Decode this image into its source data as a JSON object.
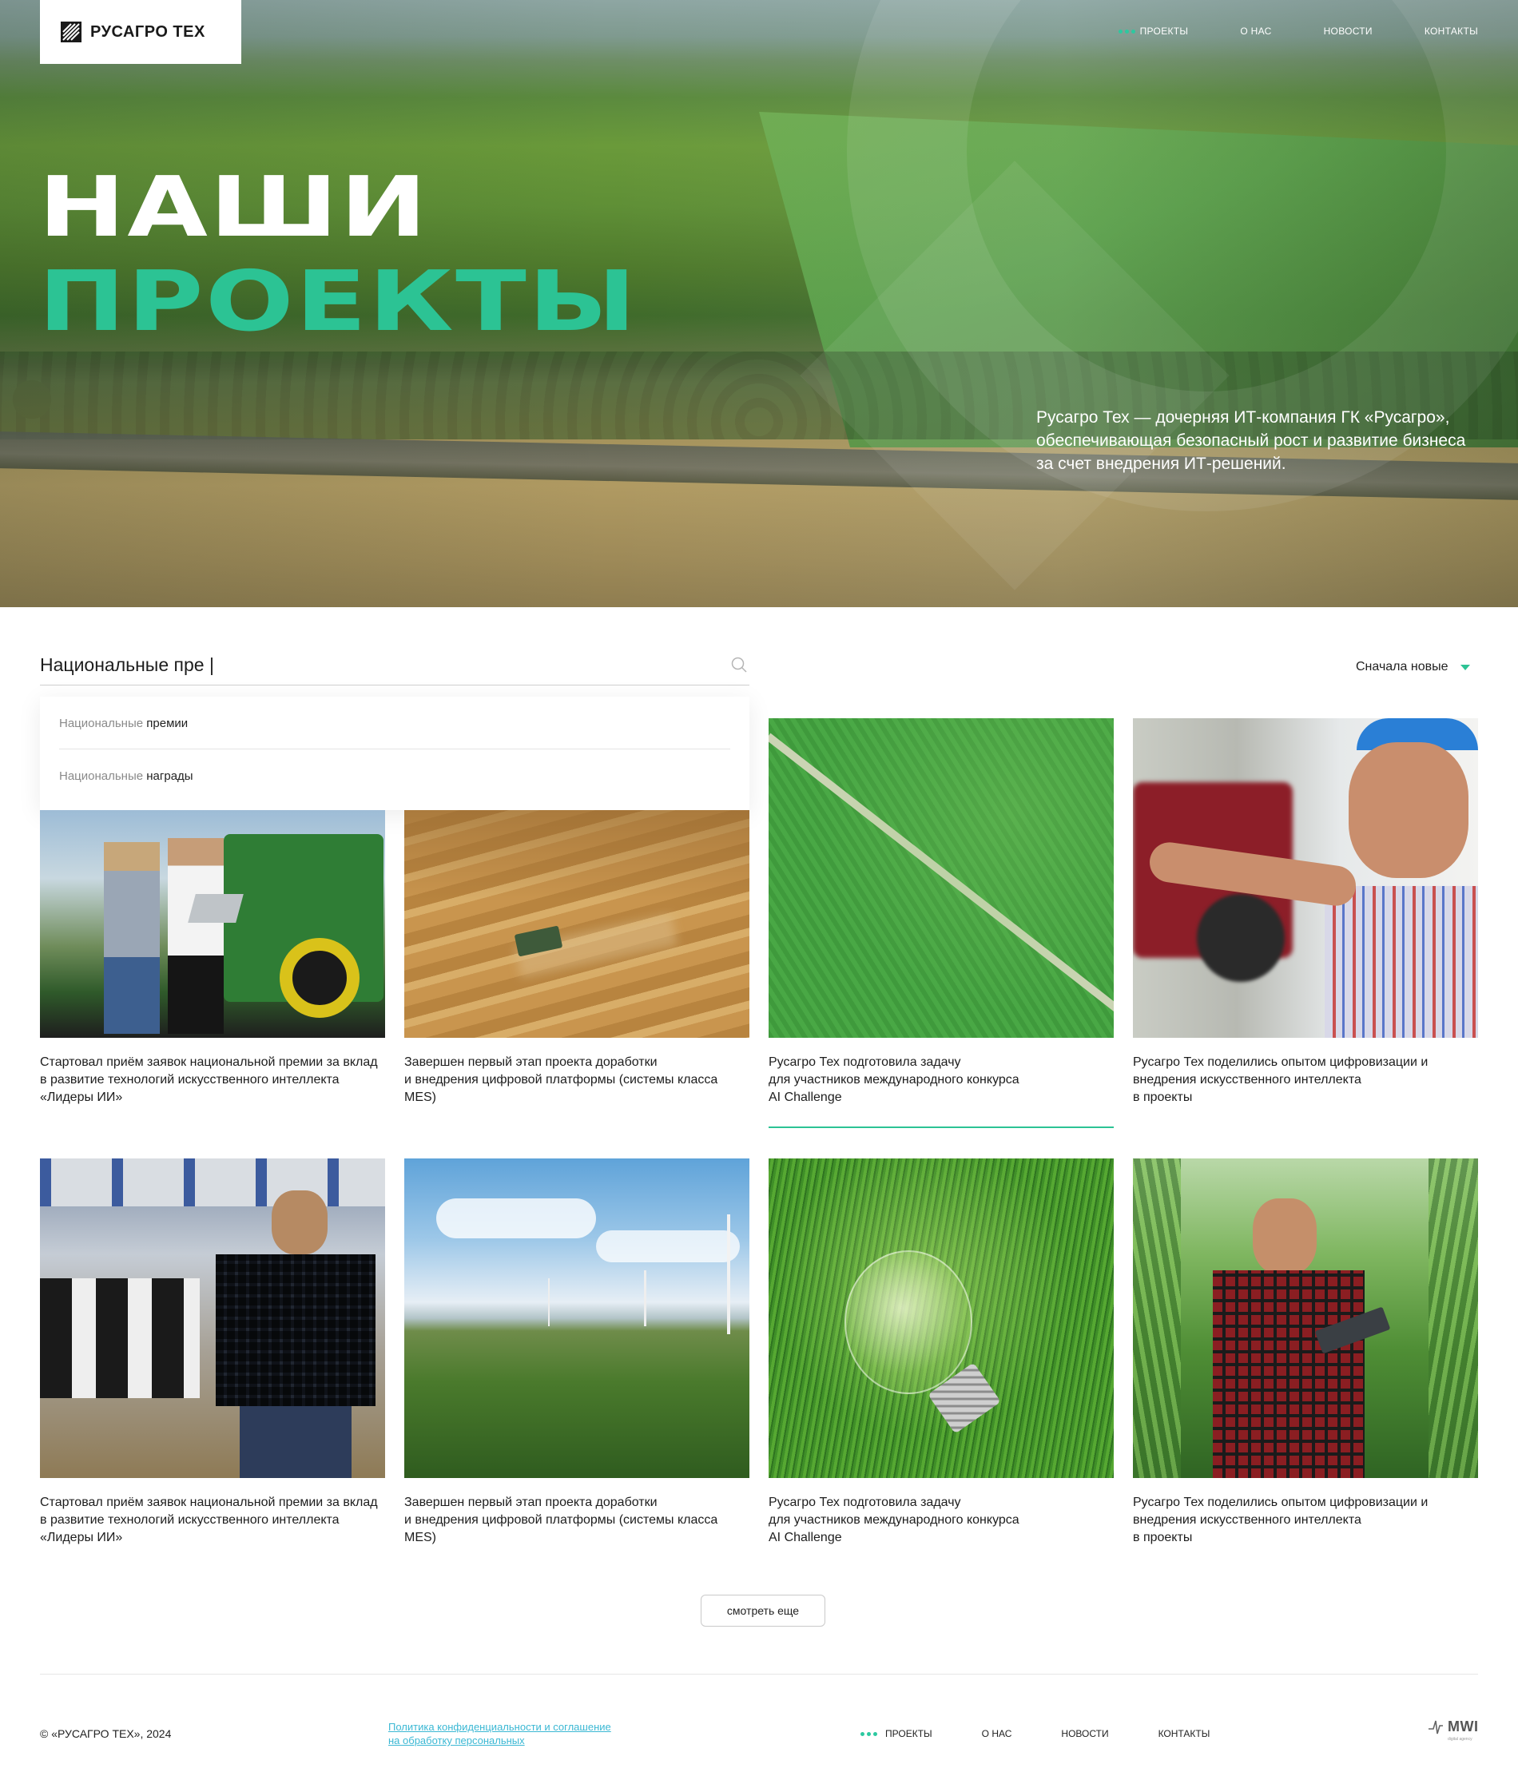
{
  "brand": {
    "name": "РУСАГРО ТЕХ",
    "accent": "#2cc394"
  },
  "nav": {
    "items": [
      {
        "label": "ПРОЕКТЫ",
        "active": true
      },
      {
        "label": "О НАС",
        "active": false
      },
      {
        "label": "НОВОСТИ",
        "active": false
      },
      {
        "label": "КОНТАКТЫ",
        "active": false
      }
    ]
  },
  "hero": {
    "title_line1": "НАШИ",
    "title_line2": "ПРОЕКТЫ",
    "description": "Русагро Тех — дочерняя ИТ-компания ГК «Русагро», обеспечивающая безопасный рост и развитие бизнеса за счет внедрения ИТ-решений."
  },
  "search": {
    "value": "Национальные пре |",
    "icon": "search-icon",
    "suggestions": [
      {
        "match": "Национальные",
        "rest": " премии"
      },
      {
        "match": "Национальные",
        "rest": " награды"
      }
    ]
  },
  "sort": {
    "label": "Сначала новые",
    "icon": "chevron-down-icon"
  },
  "cards": [
    {
      "caption": "Стартовал приём заявок национальной премии за вклад\nв развитие технологий искусственного интеллекта\n«Лидеры ИИ»",
      "image": "farmers-laptop-combine"
    },
    {
      "caption": "Завершен первый этап проекта доработки\nи внедрения цифровой платформы (системы класса\nMES)",
      "image": "aerial-harvester-field"
    },
    {
      "caption": "Русагро Тех подготовила задачу\nдля участников международного конкурса\nAI Challenge",
      "image": "aerial-green-field-road"
    },
    {
      "caption": "Русагро Тех поделились опытом цифровизации и\nвнедрения искусственного интеллекта\nв проекты",
      "image": "farmer-phone-tractor"
    },
    {
      "caption": "Стартовал приём заявок национальной премии за вклад\nв развитие технологий искусственного интеллекта\n«Лидеры ИИ»",
      "image": "man-cow-barn"
    },
    {
      "caption": "Завершен первый этап проекта доработки\nи внедрения цифровой платформы (системы класса\nMES)",
      "image": "wind-turbines-field"
    },
    {
      "caption": "Русагро Тех подготовила задачу\nдля участников международного конкурса\nAI Challenge",
      "image": "lightbulb-grass"
    },
    {
      "caption": "Русагро Тех поделились опытом цифровизации и\nвнедрения искусственного интеллекта\nв проекты",
      "image": "farmer-tablet-corn"
    }
  ],
  "more_button": "смотреть еще",
  "footer": {
    "copyright": "© «РУСАГРО ТЕХ», 2024",
    "policy": "Политика конфиденциальности и соглашение\nна обработку персональных",
    "nav": [
      {
        "label": "ПРОЕКТЫ",
        "active": true
      },
      {
        "label": "О НАС",
        "active": false
      },
      {
        "label": "НОВОСТИ",
        "active": false
      },
      {
        "label": "КОНТАКТЫ",
        "active": false
      }
    ],
    "agency": {
      "name": "MWI",
      "tagline": "digital agency"
    }
  }
}
